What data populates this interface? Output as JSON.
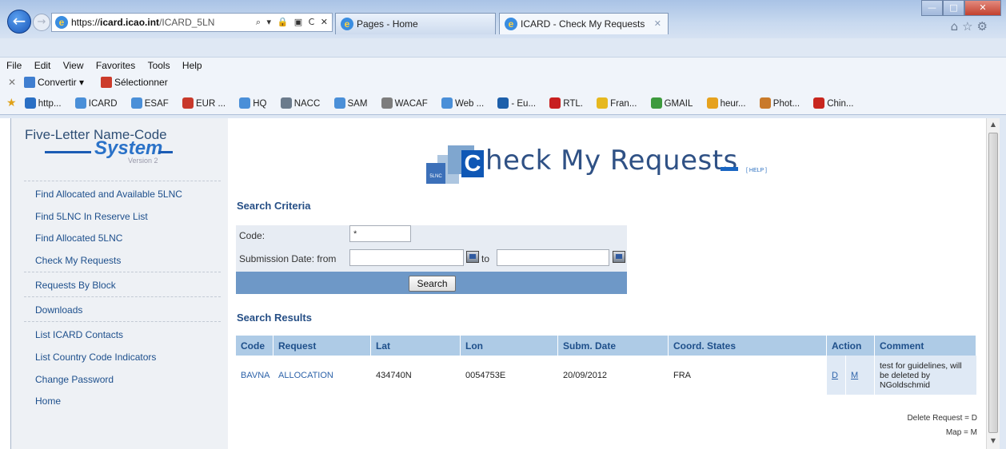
{
  "browser": {
    "url_scheme": "https://",
    "url_host": "icard.icao.int",
    "url_path": "/ICARD_5LN",
    "url_tools": "⌕ ▾ 🔒 ▣ C ✕",
    "tabs": [
      {
        "label": "Pages - Home"
      },
      {
        "label": "ICARD - Check My Requests"
      }
    ],
    "menu": [
      "File",
      "Edit",
      "View",
      "Favorites",
      "Tools",
      "Help"
    ],
    "cmdbar": {
      "convert": "Convertir",
      "select": "Sélectionner"
    },
    "favorites": [
      "http...",
      "ICARD",
      "ESAF",
      "EUR ...",
      "HQ",
      "NACC",
      "SAM",
      "WACAF",
      "Web ...",
      "- Eu...",
      "RTL.",
      "Fran...",
      "GMAIL",
      "heur...",
      "Phot...",
      "Chin..."
    ]
  },
  "logo": {
    "line1": "Five-Letter Name-Code",
    "line2": "System",
    "line3": "Version 2"
  },
  "sidebar": {
    "items": [
      {
        "label": "Find Allocated and Available 5LNC"
      },
      {
        "label": "Find 5LNC In Reserve List"
      },
      {
        "label": "Find Allocated 5LNC"
      },
      {
        "label": "Check My Requests"
      },
      {
        "label": "Requests By Block"
      },
      {
        "label": "Downloads"
      },
      {
        "label": "List ICARD Contacts"
      },
      {
        "label": "List Country Code Indicators"
      },
      {
        "label": "Change Password"
      },
      {
        "label": "Home"
      }
    ]
  },
  "header": {
    "badge": "5LNC",
    "initial": "C",
    "title": "heck My Requests",
    "help": "[ HELP ]"
  },
  "criteria": {
    "title": "Search Criteria",
    "code_label": "Code:",
    "code_value": "*",
    "date_label": "Submission Date: from",
    "to_label": "to",
    "from_value": "",
    "to_value": "",
    "search_label": "Search"
  },
  "results": {
    "title": "Search Results",
    "columns": [
      "Code",
      "Request",
      "Lat",
      "Lon",
      "Subm. Date",
      "Coord. States",
      "Action",
      "Comment"
    ],
    "rows": [
      {
        "code": "BAVNA",
        "request": "ALLOCATION",
        "lat": "434740N",
        "lon": "0054753E",
        "date": "20/09/2012",
        "states": "FRA",
        "action_d": "D",
        "action_m": "M",
        "comment": "test for guidelines, will be deleted by NGoldschmid"
      }
    ],
    "legend_delete": "Delete Request = D",
    "legend_map": "Map = M"
  }
}
